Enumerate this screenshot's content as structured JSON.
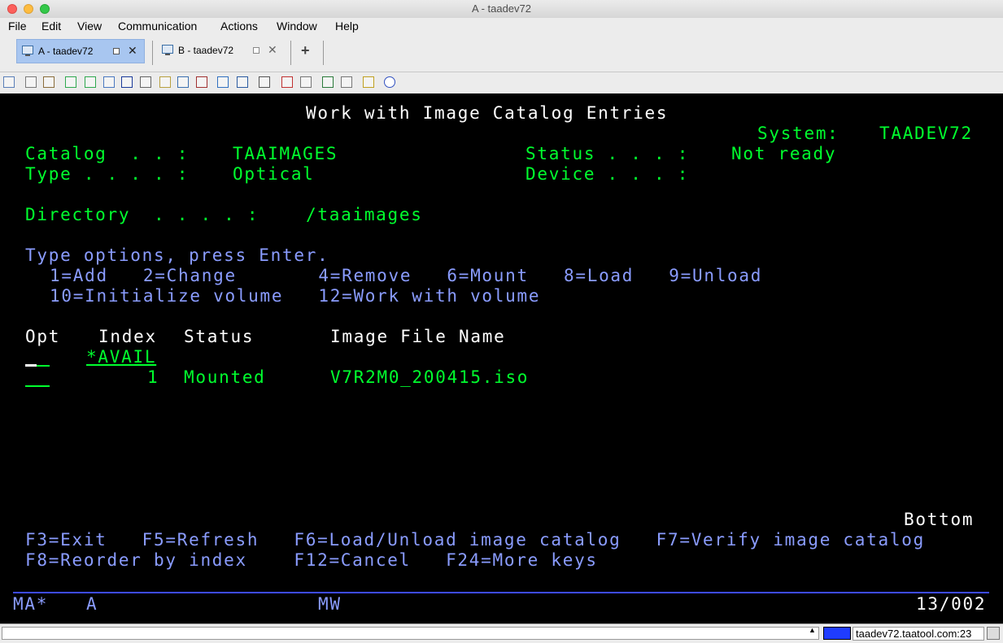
{
  "window": {
    "title": "A - taadev72"
  },
  "menu": [
    "File",
    "Edit",
    "View",
    "Communication",
    "Actions",
    "Window",
    "Help"
  ],
  "tabs": [
    {
      "label": "A - taadev72",
      "active": true
    },
    {
      "label": "B - taadev72",
      "active": false
    }
  ],
  "toolbar_icons": [
    "copy-icon",
    "paste-icon",
    "clipboard-icon",
    "upload-icon",
    "download-icon",
    "document-icon",
    "navigate-icon",
    "list-icon",
    "package-icon",
    "palette-icon",
    "record-icon",
    "image-icon",
    "grid-icon",
    "tools-icon",
    "print-icon",
    "printer-icon",
    "play-icon",
    "stop-icon",
    "notes-icon",
    "help-icon"
  ],
  "screen": {
    "title": "Work with Image Catalog Entries",
    "system_label": "System:",
    "system_value": "TAADEV72",
    "catalog_label": "Catalog  . . :",
    "catalog_value": "TAAIMAGES",
    "status_label": "Status . . . :",
    "status_value": "Not ready",
    "type_label": "Type . . . . :",
    "type_value": "Optical",
    "device_label": "Device . . . :",
    "directory_label": "Directory  . . . . :",
    "directory_value": "/taaimages",
    "instructions": "Type options, press Enter.",
    "options_line1": "1=Add   2=Change       4=Remove   6=Mount   8=Load   9=Unload",
    "options_line2": "10=Initialize volume   12=Work with volume",
    "col_opt": "Opt",
    "col_index": "Index",
    "col_status": "Status",
    "col_image": "Image File Name",
    "rows": [
      {
        "index": "*AVAIL",
        "status": "",
        "image": ""
      },
      {
        "index": "1",
        "status": "Mounted",
        "image": "V7R2M0_200415.iso"
      }
    ],
    "bottom": "Bottom",
    "fkeys_line1": "F3=Exit   F5=Refresh   F6=Load/Unload image catalog   F7=Verify image catalog",
    "fkeys_line2": "F8=Reorder by index    F12=Cancel   F24=More keys"
  },
  "oia": {
    "ma": "MA*",
    "session": "A",
    "mode": "MW",
    "cursor_pos": "13/002"
  },
  "status_bar": {
    "host": "taadev72.taatool.com:23"
  },
  "colors": {
    "terminal_bg": "#000000",
    "field_green": "#00ff2e",
    "label_blue": "#8a9cff",
    "title_white": "#ffffff",
    "tab_active": "#a8c6f0"
  }
}
